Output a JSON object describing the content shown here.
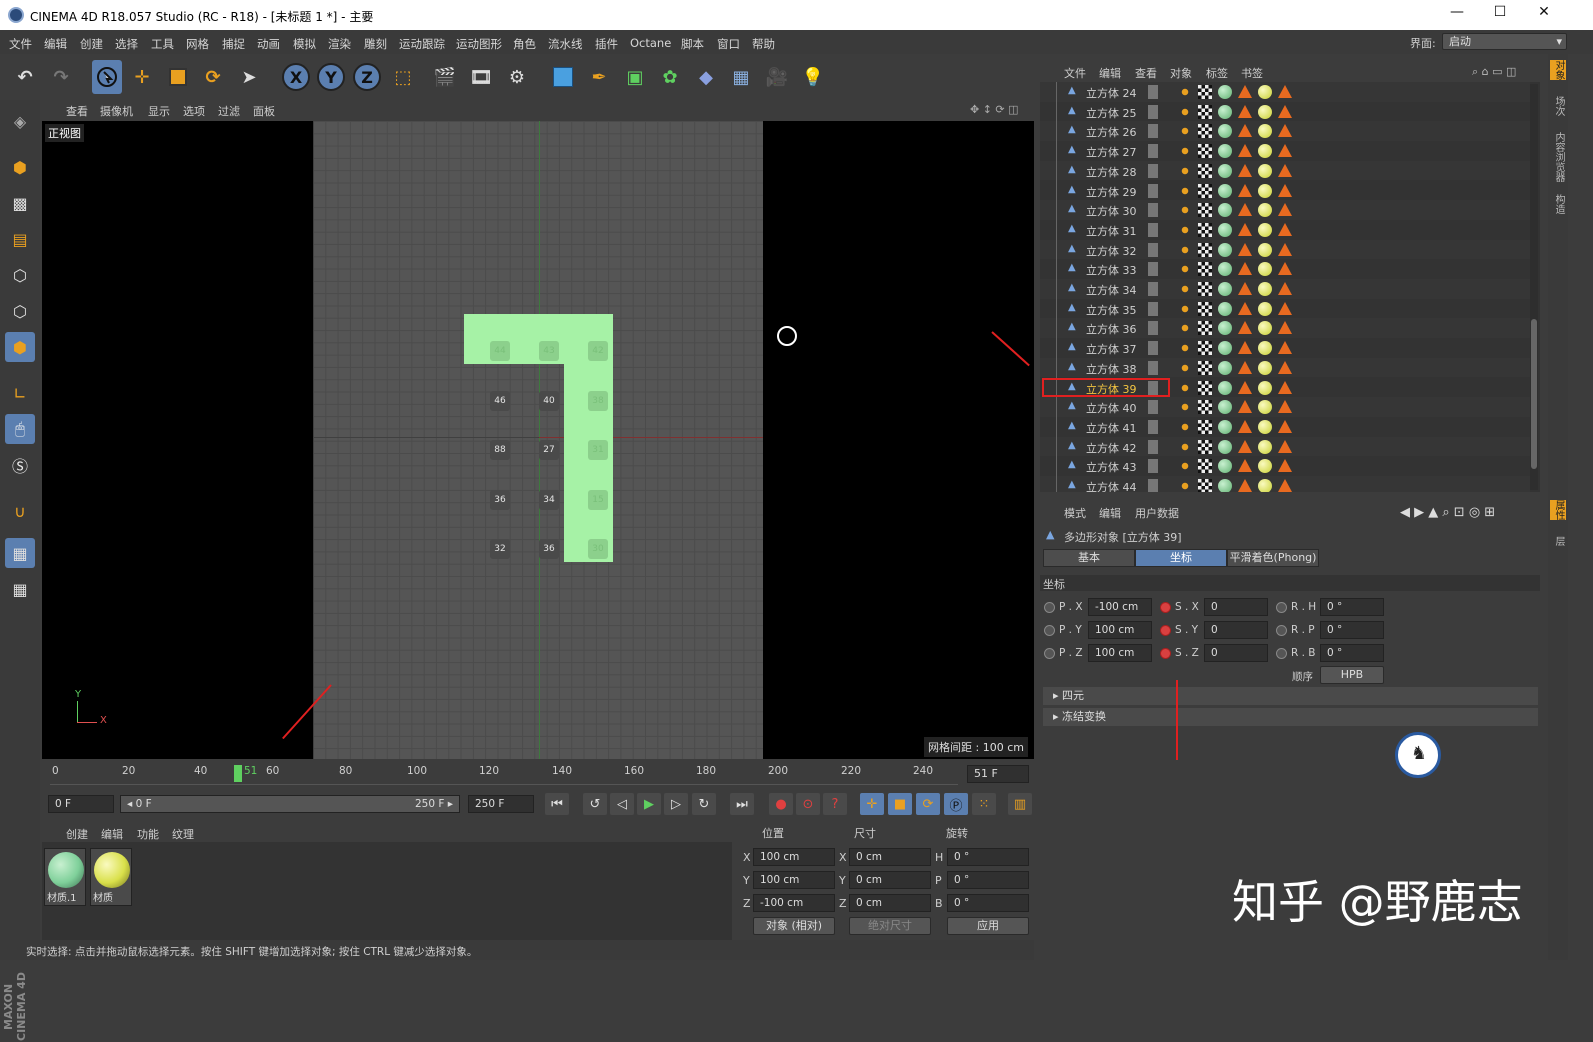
{
  "window": {
    "title": "CINEMA 4D R18.057 Studio (RC - R18) - [未标题 1 *] - 主要",
    "min_symbol": "—",
    "max_symbol": "☐",
    "close_symbol": "✕"
  },
  "menubar": {
    "items": [
      "文件",
      "编辑",
      "创建",
      "选择",
      "工具",
      "网格",
      "捕捉",
      "动画",
      "模拟",
      "渲染",
      "雕刻",
      "运动跟踪",
      "运动图形",
      "角色",
      "流水线",
      "插件",
      "Octane",
      "脚本",
      "窗口",
      "帮助"
    ],
    "layout_label": "界面:",
    "layout_value": "启动"
  },
  "toolbar": {
    "undo": "↶",
    "redo": "↷",
    "axis_x": "X",
    "axis_y": "Y",
    "axis_z": "Z"
  },
  "viewport": {
    "menu": [
      "查看",
      "摄像机",
      "显示",
      "选项",
      "过滤",
      "面板"
    ],
    "name": "正视图",
    "grid_spacing": "网格间距 : 100 cm",
    "axis_y": "Y",
    "axis_x": "X",
    "cube_labels_row1": [
      "44",
      "43",
      "42"
    ],
    "cube_labels_row2": [
      "46",
      "40",
      "38"
    ],
    "cube_labels_row3": [
      "88",
      "27",
      "31"
    ],
    "cube_labels_row4": [
      "36",
      "34",
      "15"
    ],
    "cube_labels_row5": [
      "32",
      "36",
      "30"
    ]
  },
  "timeline": {
    "ticks": [
      "0",
      "20",
      "40",
      "60",
      "80",
      "100",
      "120",
      "140",
      "160",
      "180",
      "200",
      "220",
      "240"
    ],
    "current_marker": "51",
    "current_frame": "51 F"
  },
  "transport": {
    "start": "0 F",
    "range_start": "◂ 0 F",
    "range_end": "250 F ▸",
    "end": "250 F"
  },
  "materials": {
    "menu": [
      "创建",
      "编辑",
      "功能",
      "纹理"
    ],
    "items": [
      {
        "name": "材质.1",
        "color": "#7fd09a"
      },
      {
        "name": "材质",
        "color": "#d9e04a"
      }
    ]
  },
  "coords": {
    "headers": [
      "位置",
      "尺寸",
      "旋转"
    ],
    "rows": [
      {
        "axis": "X",
        "pos": "100 cm",
        "size_axis": "X",
        "size": "0 cm",
        "rot_axis": "H",
        "rot": "0 °"
      },
      {
        "axis": "Y",
        "pos": "100 cm",
        "size_axis": "Y",
        "size": "0 cm",
        "rot_axis": "P",
        "rot": "0 °"
      },
      {
        "axis": "Z",
        "pos": "-100 cm",
        "size_axis": "Z",
        "size": "0 cm",
        "rot_axis": "B",
        "rot": "0 °"
      }
    ],
    "mode": "对象 (相对)",
    "size_mode": "绝对尺寸",
    "apply": "应用"
  },
  "status": {
    "text": "实时选择: 点击并拖动鼠标选择元素。按住 SHIFT 键增加选择对象; 按住 CTRL 键减少选择对象。"
  },
  "object_manager": {
    "menu": [
      "文件",
      "编辑",
      "查看",
      "对象",
      "标签",
      "书签"
    ],
    "objects": [
      "立方体 24",
      "立方体 25",
      "立方体 26",
      "立方体 27",
      "立方体 28",
      "立方体 29",
      "立方体 30",
      "立方体 31",
      "立方体 32",
      "立方体 33",
      "立方体 34",
      "立方体 35",
      "立方体 36",
      "立方体 37",
      "立方体 38",
      "立方体 39",
      "立方体 40",
      "立方体 41",
      "立方体 42",
      "立方体 43",
      "立方体 44"
    ],
    "selected": "立方体 39"
  },
  "attribute_manager": {
    "menu": [
      "模式",
      "编辑",
      "用户数据"
    ],
    "object_title": "多边形对象 [立方体 39]",
    "tabs": [
      "基本",
      "坐标",
      "平滑着色(Phong)"
    ],
    "active_tab": "坐标",
    "section": "坐标",
    "pos": {
      "x_label": "P . X",
      "x": "-100 cm",
      "y_label": "P . Y",
      "y": "100 cm",
      "z_label": "P . Z",
      "z": "100 cm"
    },
    "scale": {
      "x_label": "S . X",
      "x": "0",
      "y_label": "S . Y",
      "y": "0",
      "z_label": "S . Z",
      "z": "0"
    },
    "rot": {
      "h_label": "R . H",
      "h": "0 °",
      "p_label": "R . P",
      "p": "0 °",
      "b_label": "R . B",
      "b": "0 °"
    },
    "order_label": "顺序",
    "order_value": "HPB",
    "collapsed_1": "四元",
    "collapsed_2": "冻结变换"
  },
  "right_tabs": [
    "对象",
    "场次",
    "内容浏览器",
    "构造",
    "属性",
    "层"
  ],
  "watermark": "知乎 @野鹿志",
  "maxon_logo": "MAXON CINEMA 4D"
}
